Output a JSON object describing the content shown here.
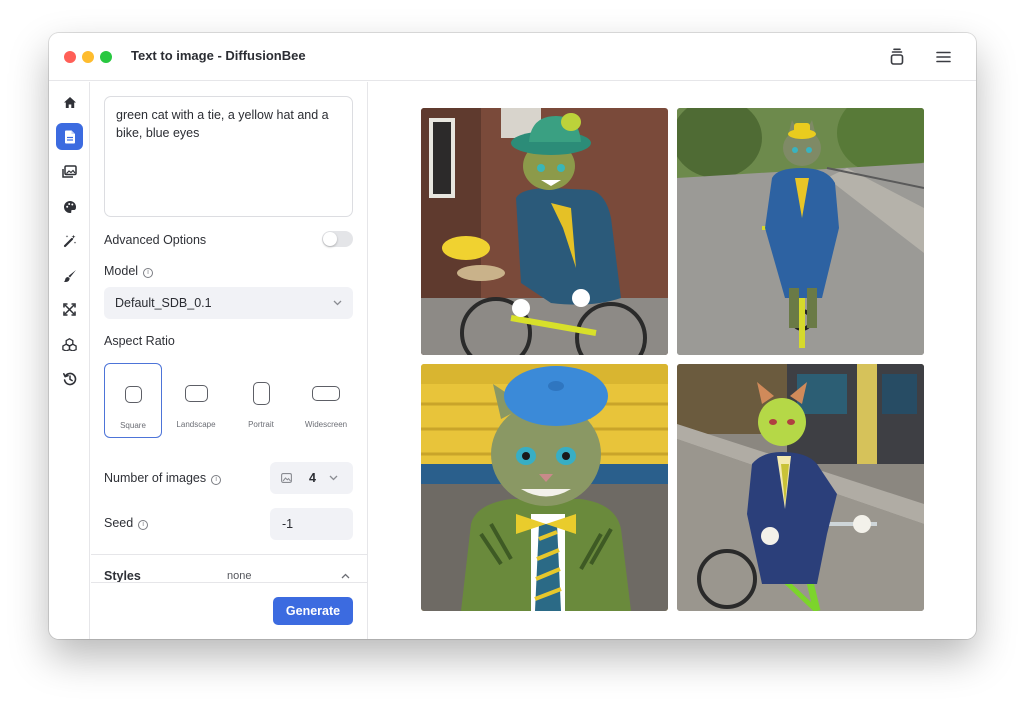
{
  "window": {
    "title": "Text to image - DiffusionBee"
  },
  "titlebar": {
    "buttons": [
      {
        "icon": "stack-icon"
      },
      {
        "icon": "hamburger-menu-icon"
      }
    ]
  },
  "sidebar": {
    "items": [
      {
        "icon": "home-icon",
        "active": false
      },
      {
        "icon": "text-to-image-icon",
        "active": true
      },
      {
        "icon": "gallery-icon",
        "active": false
      },
      {
        "icon": "palette-icon",
        "active": false
      },
      {
        "icon": "magic-wand-icon",
        "active": false
      },
      {
        "icon": "brush-icon",
        "active": false
      },
      {
        "icon": "upscale-icon",
        "active": false
      },
      {
        "icon": "models-icon",
        "active": false
      },
      {
        "icon": "history-icon",
        "active": false
      }
    ]
  },
  "prompt": {
    "text": "green cat with a tie, a yellow hat and a bike, blue eyes"
  },
  "advanced_options": {
    "label": "Advanced Options",
    "enabled": false
  },
  "model": {
    "label": "Model",
    "value": "Default_SDB_0.1"
  },
  "aspect_ratio": {
    "label": "Aspect Ratio",
    "options": [
      {
        "name": "Square",
        "selected": true
      },
      {
        "name": "Landscape",
        "selected": false
      },
      {
        "name": "Portrait",
        "selected": false
      },
      {
        "name": "Widescreen",
        "selected": false
      }
    ]
  },
  "num_images": {
    "label": "Number of images",
    "value": "4"
  },
  "seed": {
    "label": "Seed",
    "value": "-1"
  },
  "styles": {
    "label": "Styles",
    "value": "none"
  },
  "generate": {
    "label": "Generate"
  },
  "colors": {
    "accent": "#3c6be0",
    "field_bg": "#f1f2f6",
    "border": "#e6e6e9"
  },
  "images": [
    {
      "name": "generated-image-1"
    },
    {
      "name": "generated-image-2"
    },
    {
      "name": "generated-image-3"
    },
    {
      "name": "generated-image-4"
    }
  ]
}
